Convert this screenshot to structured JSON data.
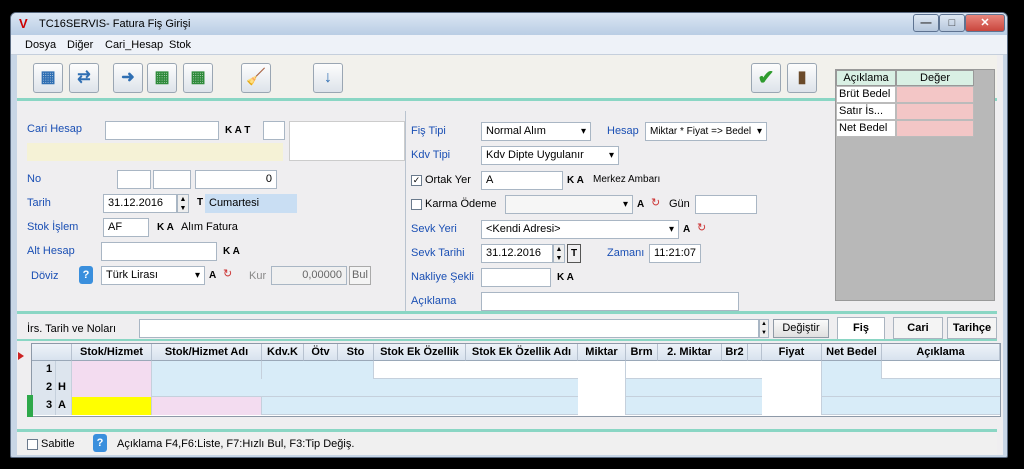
{
  "window": {
    "title": "TC16SERVIS-      Fatura Fiş Girişi",
    "min_label": "—",
    "max_label": "□",
    "close_label": "✕"
  },
  "menu": [
    "Dosya",
    "Diğer",
    "Cari_Hesap",
    "Stok"
  ],
  "toolbar": {
    "icons": [
      "grid-refresh-icon",
      "refresh-icon",
      "next-icon",
      "table-edit-icon",
      "table-refresh-icon",
      "broom-icon",
      "sort-icon",
      "confirm-icon",
      "exit-icon"
    ],
    "glyphs": {
      "grid": "▦",
      "refresh": "⇄",
      "next": "➜",
      "tedit": "▦",
      "trefresh": "▦",
      "broom": "🧹",
      "sort": "↓",
      "ok": "✔",
      "exit": "▮"
    }
  },
  "left": {
    "cari_hesap_label": "Cari Hesap",
    "cari_hesap_value": "",
    "no_label": "No",
    "no_value": "0",
    "tarih_label": "Tarih",
    "tarih_value": "31.12.2016",
    "tarih_day": "Cumartesi",
    "stok_islem_label": "Stok İşlem",
    "stok_islem_code": "AF",
    "stok_islem_desc": "Alım Fatura",
    "alt_hesap_label": "Alt Hesap",
    "doviz_label": "Döviz",
    "doviz_value": "Türk Lirası",
    "kur_label": "Kur",
    "kur_value": "0,00000",
    "bul_label": "Bul",
    "ka": "K A",
    "kat": "K A T",
    "a": "A",
    "t": "T"
  },
  "middle": {
    "fis_tipi_label": "Fiş Tipi",
    "fis_tipi_value": "Normal Alım",
    "hesap_label": "Hesap",
    "hesap_value": "Miktar * Fiyat => Bedel",
    "kdv_tipi_label": "Kdv Tipi",
    "kdv_tipi_value": "Kdv Dipte Uygulanır",
    "ortak_yer_label": "Ortak Yer",
    "ortak_yer_code": "A",
    "ortak_yer_desc": "Merkez Ambarı",
    "karma_odeme_label": "Karma Ödeme",
    "gun_label": "Gün",
    "sevk_yeri_label": "Sevk Yeri",
    "sevk_yeri_value": "<Kendi Adresi>",
    "sevk_tarihi_label": "Sevk Tarihi",
    "sevk_tarihi_value": "31.12.2016",
    "zamani_label": "Zamanı",
    "zamani_value": "11:21:07",
    "nakliye_label": "Nakliye Şekli",
    "aciklama_label": "Açıklama",
    "ortak_checked": true,
    "karma_checked": false,
    "check_mark": "✓"
  },
  "summary": {
    "col_aciklama": "Açıklama",
    "col_deger": "Değer",
    "rows": [
      "Brüt Bedel",
      "Satır İs...",
      "Net Bedel"
    ]
  },
  "irs": {
    "label": "İrs. Tarih ve Noları",
    "degistir": "Değiştir"
  },
  "tabs": [
    "Fiş",
    "Cari",
    "Tarihçe"
  ],
  "grid": {
    "headers": [
      "Stok/Hizmet",
      "Stok/Hizmet Adı",
      "Kdv.K",
      "Ötv",
      "Sto",
      "Stok Ek Özellik",
      "Stok Ek Özellik Adı",
      "Miktar",
      "Brm",
      "2. Miktar",
      "Br2",
      "Fiyat",
      "Net Bedel",
      "Açıklama"
    ],
    "rows": [
      {
        "num": "1",
        "flag": ""
      },
      {
        "num": "2",
        "flag": "H"
      },
      {
        "num": "3",
        "flag": "A"
      }
    ]
  },
  "status": {
    "sabitle_label": "Sabitle",
    "hint": "Açıklama F4,F6:Liste, F7:Hızlı Bul, F3:Tip Değiş."
  },
  "colors": {
    "accent_green": "#8ad6c4",
    "label_blue": "#1a4fb4",
    "summary_pink": "#f3c6c6",
    "grid_pink": "#f3dcf0",
    "grid_yellow": "#ffff00",
    "row_blue": "#d8ecf8",
    "close_red": "#c9463d"
  }
}
